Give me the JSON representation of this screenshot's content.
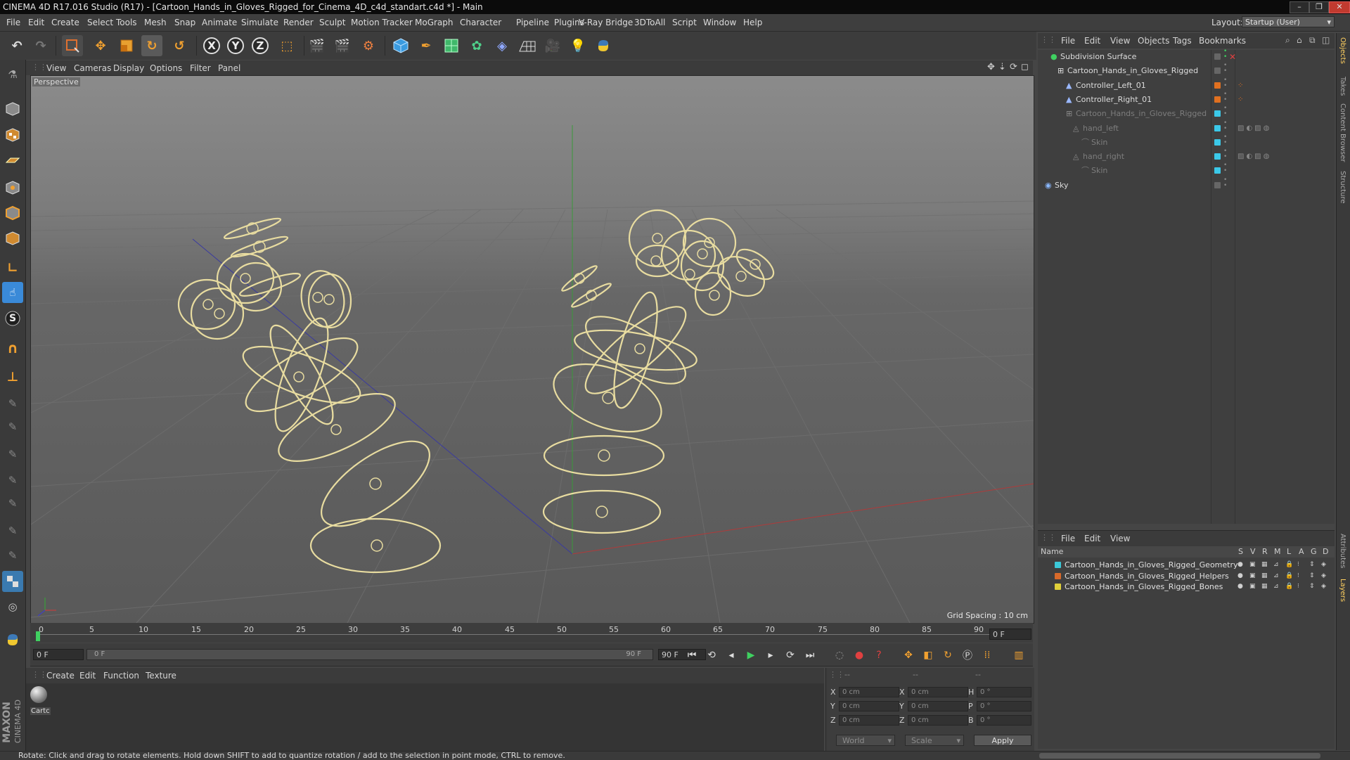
{
  "window": {
    "title": "CINEMA 4D R17.016 Studio (R17) - [Cartoon_Hands_in_Gloves_Rigged_for_Cinema_4D_c4d_standart.c4d *] - Main",
    "buttons": [
      "–",
      "❐",
      "✕"
    ]
  },
  "menubar": {
    "items": [
      "File",
      "Edit",
      "Create",
      "Select",
      "Tools",
      "Mesh",
      "Snap",
      "Animate",
      "Simulate",
      "Render",
      "Sculpt",
      "Motion Tracker",
      "MoGraph",
      "Character",
      "Pipeline",
      "Plugins",
      "V-Ray Bridge",
      "3DToAll",
      "Script",
      "Window",
      "Help"
    ],
    "layout_label": "Layout:",
    "layout_value": "Startup (User)"
  },
  "toolbar": {
    "axis_x": "X",
    "axis_y": "Y",
    "axis_z": "Z"
  },
  "left_toolbar": {
    "s_label": "S"
  },
  "viewport": {
    "menu": [
      "View",
      "Cameras",
      "Display",
      "Options",
      "Filter",
      "Panel"
    ],
    "label": "Perspective",
    "grid_spacing": "Grid Spacing : 10 cm"
  },
  "timeline": {
    "ticks": [
      "0",
      "5",
      "10",
      "15",
      "20",
      "25",
      "30",
      "35",
      "40",
      "45",
      "50",
      "55",
      "60",
      "65",
      "70",
      "75",
      "80",
      "85",
      "90"
    ],
    "current_frame": "0 F",
    "start_field": "0 F",
    "range_start": "0 F",
    "range_end": "90 F",
    "end_field": "90 F"
  },
  "material_manager": {
    "menu": [
      "Create",
      "Edit",
      "Function",
      "Texture"
    ],
    "material_name": "Cartc"
  },
  "coordinates": {
    "header": [
      "--",
      "--",
      "--"
    ],
    "rows": [
      {
        "a": "X",
        "av": "0 cm",
        "b": "X",
        "bv": "0 cm",
        "c": "H",
        "cv": "0 °"
      },
      {
        "a": "Y",
        "av": "0 cm",
        "b": "Y",
        "bv": "0 cm",
        "c": "P",
        "cv": "0 °"
      },
      {
        "a": "Z",
        "av": "0 cm",
        "b": "Z",
        "bv": "0 cm",
        "c": "B",
        "cv": "0 °"
      }
    ],
    "mode_world": "World",
    "mode_scale": "Scale",
    "apply": "Apply"
  },
  "status_bar": {
    "text": "Rotate: Click and drag to rotate elements. Hold down SHIFT to add to quantize rotation / add to the selection in point mode, CTRL to remove."
  },
  "object_manager": {
    "menu": [
      "File",
      "Edit",
      "View",
      "Objects",
      "Tags",
      "Bookmarks"
    ],
    "objects": [
      {
        "name": "Subdivision Surface",
        "color": "#dcdcdc",
        "indent": 0
      },
      {
        "name": "Cartoon_Hands_in_Gloves_Rigged",
        "color": "#dcdcdc",
        "indent": 1
      },
      {
        "name": "Controller_Left_01",
        "color": "#dcdcdc",
        "indent": 2
      },
      {
        "name": "Controller_Right_01",
        "color": "#dcdcdc",
        "indent": 2
      },
      {
        "name": "Cartoon_Hands_in_Gloves_Rigged",
        "color": "#7d7d7d",
        "indent": 2
      },
      {
        "name": "hand_left",
        "color": "#7d7d7d",
        "indent": 3
      },
      {
        "name": "Skin",
        "color": "#7d7d7d",
        "indent": 4
      },
      {
        "name": "hand_right",
        "color": "#7d7d7d",
        "indent": 3
      },
      {
        "name": "Skin",
        "color": "#7d7d7d",
        "indent": 4
      },
      {
        "name": "Sky",
        "color": "#dcdcdc",
        "indent": 0
      }
    ]
  },
  "layer_manager": {
    "menu": [
      "File",
      "Edit",
      "View"
    ],
    "header": {
      "name": "Name",
      "cols": [
        "S",
        "V",
        "R",
        "M",
        "L",
        "A",
        "G",
        "D"
      ]
    },
    "layers": [
      {
        "name": "Cartoon_Hands_in_Gloves_Rigged_Geometry",
        "color": "#3bc8d8"
      },
      {
        "name": "Cartoon_Hands_in_Gloves_Rigged_Helpers",
        "color": "#d86a2a"
      },
      {
        "name": "Cartoon_Hands_in_Gloves_Rigged_Bones",
        "color": "#e0d03a"
      }
    ]
  },
  "right_tabs": [
    "Objects",
    "Takes",
    "Content Browser",
    "Structure",
    "Attributes",
    "Layers"
  ],
  "branding": {
    "line1": "MAXON",
    "line2": "CINEMA 4D"
  }
}
